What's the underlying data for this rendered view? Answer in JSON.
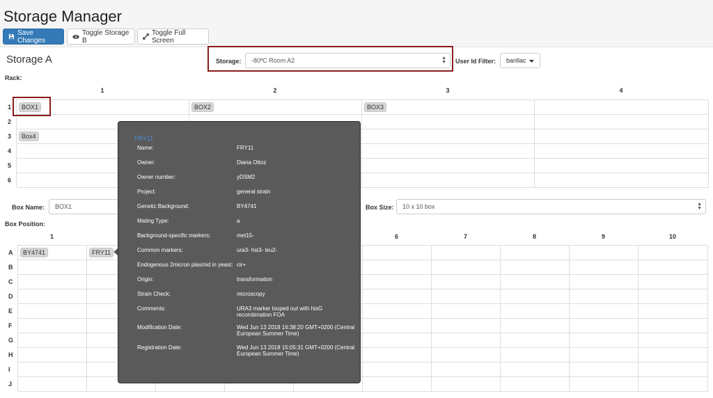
{
  "app_title": "Storage Manager",
  "toolbar": {
    "save_label": "Save Changes",
    "toggle_storage_label": "Toggle Storage B",
    "toggle_fullscreen_label": "Toggle Full Screen"
  },
  "storage_panel": {
    "title": "Storage A",
    "storage_label": "Storage:",
    "storage_value": "-80ºC Room A2",
    "user_filter_label": "User Id Filter:",
    "user_filter_value": "barillac",
    "rack_label": "Rack:"
  },
  "rack": {
    "columns": [
      "1",
      "2",
      "3",
      "4"
    ],
    "rows": [
      "1",
      "2",
      "3",
      "4",
      "5",
      "6"
    ],
    "boxes": [
      {
        "row": 1,
        "col": 1,
        "label": "BOX1"
      },
      {
        "row": 1,
        "col": 2,
        "label": "BOX2"
      },
      {
        "row": 1,
        "col": 3,
        "label": "BOX3"
      },
      {
        "row": 3,
        "col": 1,
        "label": "Box4"
      }
    ]
  },
  "box_form": {
    "name_label": "Box Name:",
    "name_value": "BOX1",
    "size_label": "Box Size:",
    "size_value": "10 x 10 box",
    "position_label": "Box Position:"
  },
  "box_grid": {
    "columns": [
      "1",
      "2",
      "3",
      "4",
      "5",
      "6",
      "7",
      "8",
      "9",
      "10"
    ],
    "rows": [
      "A",
      "B",
      "C",
      "D",
      "E",
      "F",
      "G",
      "H",
      "I",
      "J"
    ],
    "items": [
      {
        "row": 1,
        "col": 1,
        "label": "BY4741"
      },
      {
        "row": 1,
        "col": 2,
        "label": "FRY11"
      }
    ]
  },
  "tooltip": {
    "title": "FRY11",
    "fields": [
      {
        "key": "Name:",
        "value": "FRY11"
      },
      {
        "key": "Owner:",
        "value": "Diana Ottoz"
      },
      {
        "key": "Owner number:",
        "value": "yDSM2"
      },
      {
        "key": "Project:",
        "value": "general strain"
      },
      {
        "key": "Genetic Background:",
        "value": "BY4741"
      },
      {
        "key": "Mating Type:",
        "value": "a"
      },
      {
        "key": "Background-specific markers:",
        "value": "met15-"
      },
      {
        "key": "Common markers:",
        "value": "ura3- his3- leu2-"
      },
      {
        "key": "Endogenous 2micron plasmid in yeast:",
        "value": "cir+"
      },
      {
        "key": "Origin:",
        "value": "transformation"
      },
      {
        "key": "Strain Check:",
        "value": "microscopy"
      },
      {
        "key": "Comments:",
        "value": "URA3 marker looped out with hisG recombination FOA"
      },
      {
        "key": "Modification Date:",
        "value": "Wed Jun 13 2018 16:38:20 GMT+0200 (Central European Summer Time)"
      },
      {
        "key": "Registration Date:",
        "value": "Wed Jun 13 2018 15:05:31 GMT+0200 (Central European Summer Time)"
      }
    ]
  }
}
